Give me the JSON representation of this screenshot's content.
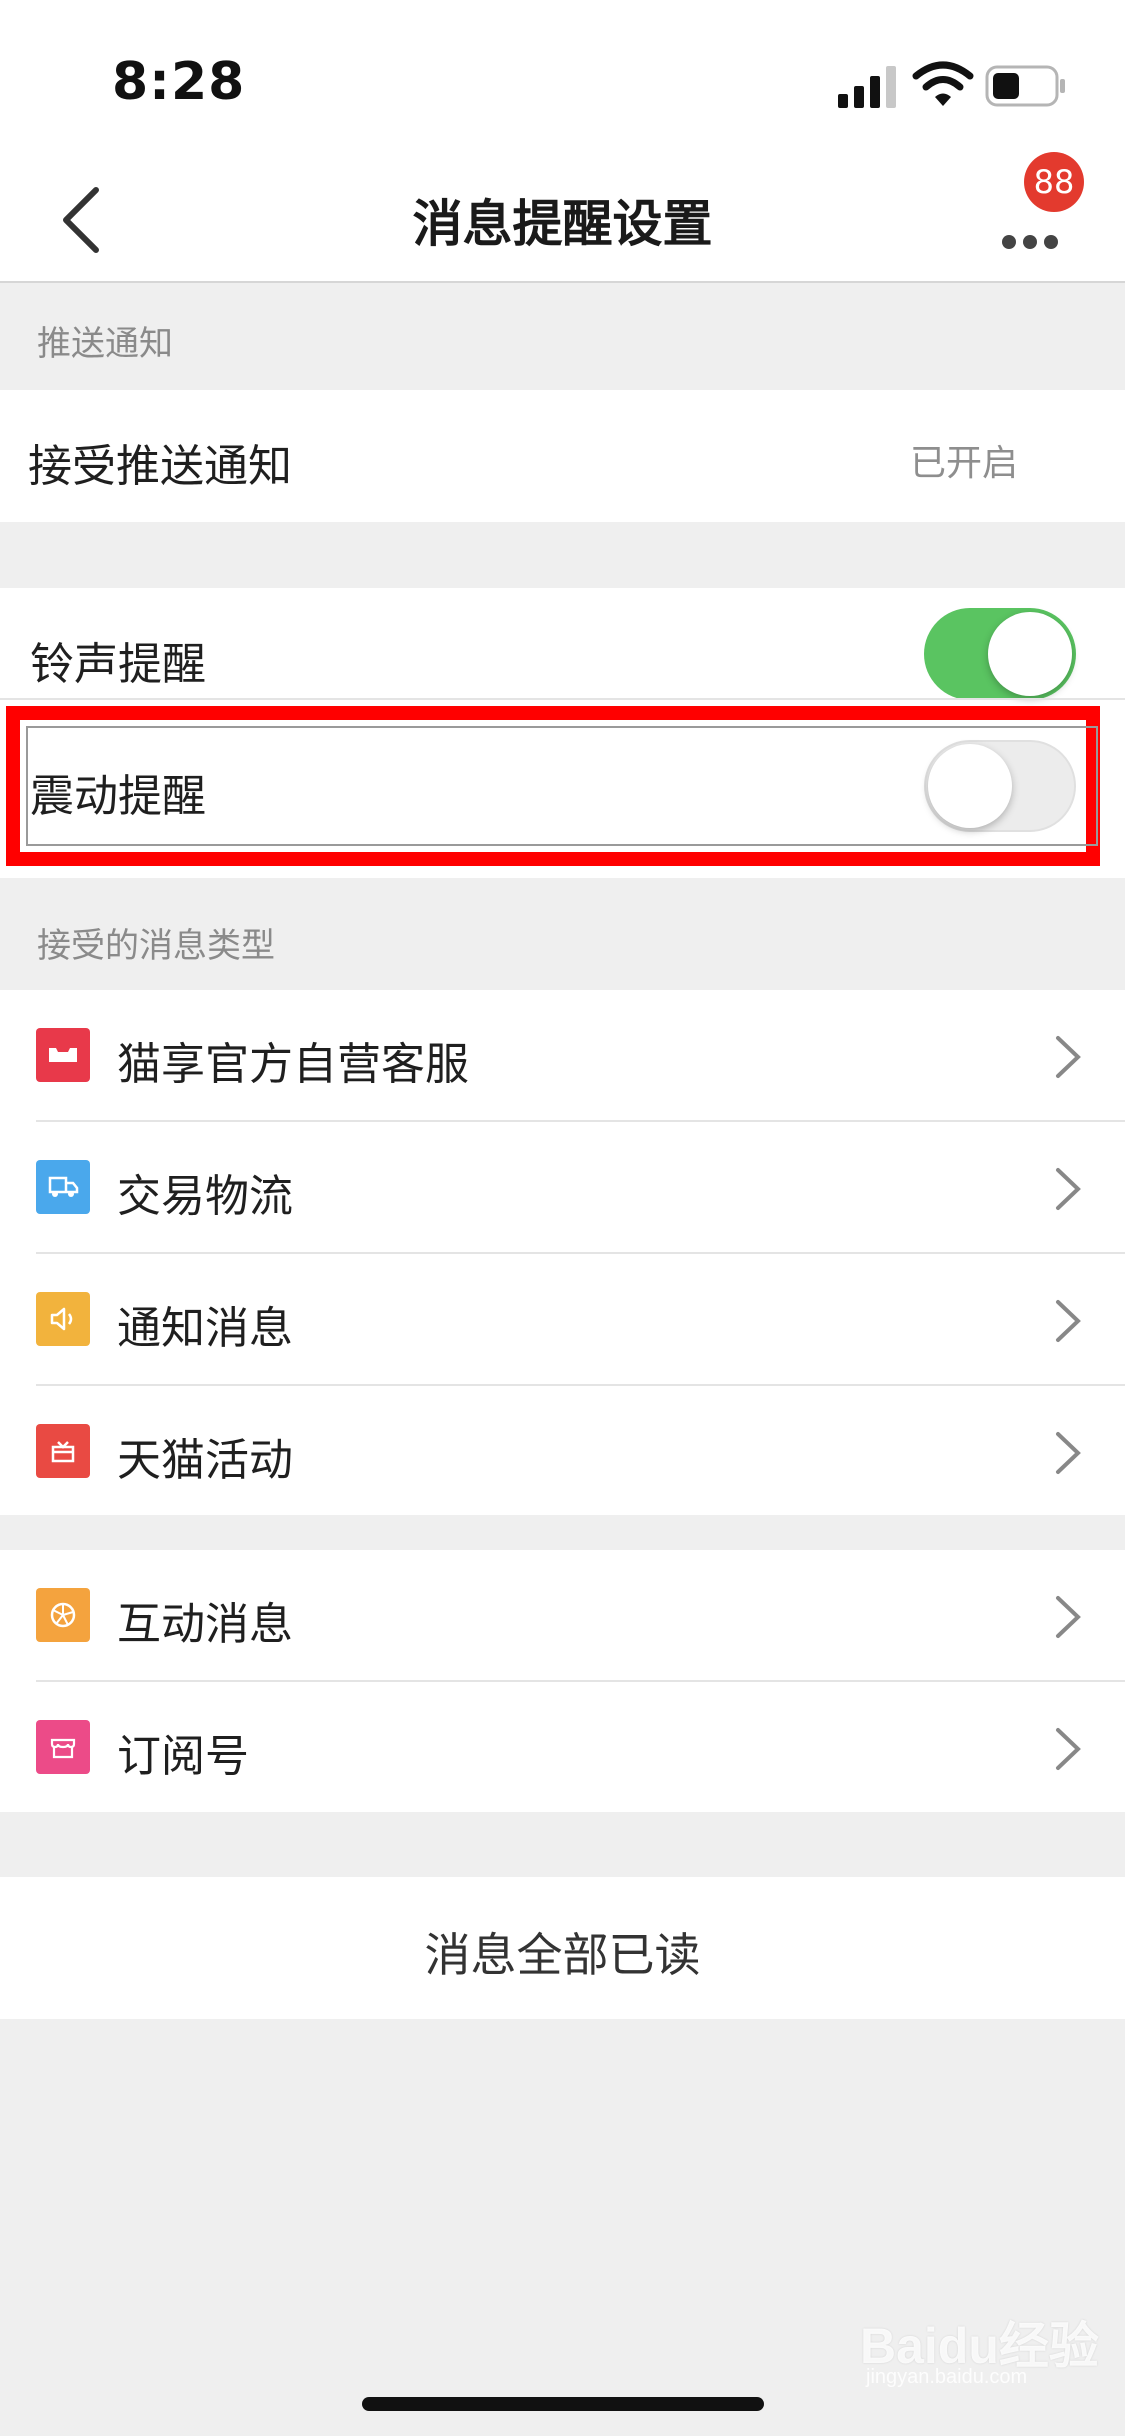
{
  "status_bar": {
    "time": "8:28"
  },
  "nav": {
    "title": "消息提醒设置",
    "badge_count": "88"
  },
  "sections": {
    "push": {
      "header": "推送通知",
      "row_label": "接受推送通知",
      "row_value": "已开启"
    },
    "alerts": {
      "ringtone_label": "铃声提醒",
      "ringtone_on": true,
      "vibrate_label": "震动提醒",
      "vibrate_on": false
    },
    "types": {
      "header": "接受的消息类型",
      "items": [
        {
          "label": "猫享官方自营客服",
          "icon": "store-icon",
          "color": "#e8394a"
        },
        {
          "label": "交易物流",
          "icon": "truck-icon",
          "color": "#4aa8ec"
        },
        {
          "label": "通知消息",
          "icon": "speaker-icon",
          "color": "#f2b33d"
        },
        {
          "label": "天猫活动",
          "icon": "gift-icon",
          "color": "#e94a43"
        },
        {
          "label": "互动消息",
          "icon": "aperture-icon",
          "color": "#f4a33e"
        },
        {
          "label": "订阅号",
          "icon": "shop-icon",
          "color": "#ec4b88"
        }
      ]
    }
  },
  "footer": {
    "mark_all_read": "消息全部已读"
  },
  "watermark": {
    "brand": "Baidu经验",
    "url": "jingyan.baidu.com"
  }
}
